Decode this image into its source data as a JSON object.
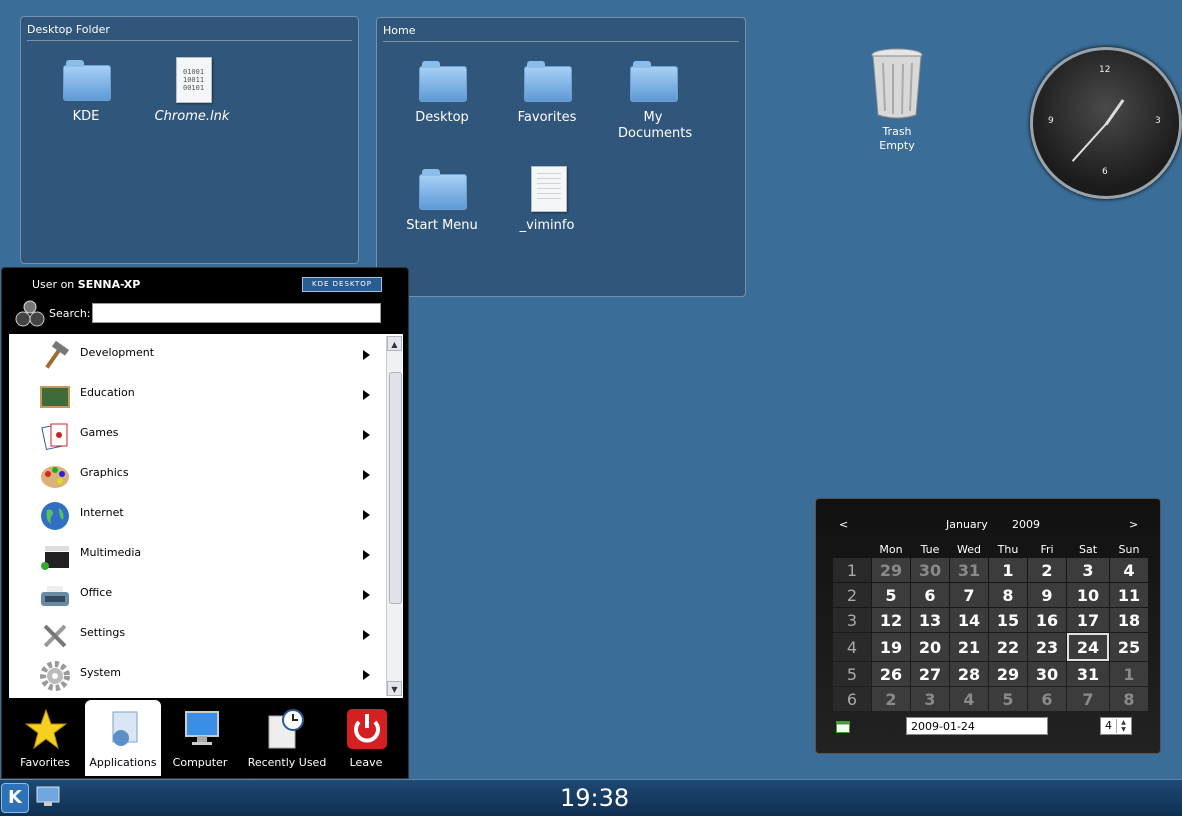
{
  "desktop_folder": {
    "title": "Desktop Folder",
    "items": [
      {
        "label": "KDE",
        "type": "folder"
      },
      {
        "label": "Chrome.lnk",
        "type": "file"
      }
    ]
  },
  "home_folder": {
    "title": "Home",
    "items": [
      {
        "label": "Desktop",
        "type": "folder"
      },
      {
        "label": "Favorites",
        "type": "folder"
      },
      {
        "label": "My Documents",
        "type": "folder"
      },
      {
        "label": "Start Menu",
        "type": "folder"
      },
      {
        "label": "_viminfo",
        "type": "file"
      }
    ]
  },
  "trash": {
    "label": "Trash",
    "status": "Empty"
  },
  "clock_widget": {
    "numerals": [
      "12",
      "3",
      "6",
      "9"
    ]
  },
  "calendar": {
    "prev": "<",
    "next": ">",
    "month": "January",
    "year": "2009",
    "weekdays": [
      "Mon",
      "Tue",
      "Wed",
      "Thu",
      "Fri",
      "Sat",
      "Sun"
    ],
    "weeks": [
      {
        "num": "1",
        "days": [
          "29",
          "30",
          "31",
          "1",
          "2",
          "3",
          "4"
        ]
      },
      {
        "num": "2",
        "days": [
          "5",
          "6",
          "7",
          "8",
          "9",
          "10",
          "11"
        ]
      },
      {
        "num": "3",
        "days": [
          "12",
          "13",
          "14",
          "15",
          "16",
          "17",
          "18"
        ]
      },
      {
        "num": "4",
        "days": [
          "19",
          "20",
          "21",
          "22",
          "23",
          "24",
          "25"
        ]
      },
      {
        "num": "5",
        "days": [
          "26",
          "27",
          "28",
          "29",
          "30",
          "31",
          "1"
        ]
      },
      {
        "num": "6",
        "days": [
          "2",
          "3",
          "4",
          "5",
          "6",
          "7",
          "8"
        ]
      }
    ],
    "date_field": "2009-01-24",
    "week_spin": "4",
    "selected_day": "24"
  },
  "launcher": {
    "user_prefix": "User on",
    "host": "SENNA-XP",
    "badge": "KDE DESKTOP",
    "search_label": "Search:",
    "search_value": "",
    "apps": [
      {
        "label": "Development",
        "icon": "hammer-icon"
      },
      {
        "label": "Education",
        "icon": "chalkboard-icon"
      },
      {
        "label": "Games",
        "icon": "cards-icon"
      },
      {
        "label": "Graphics",
        "icon": "palette-icon"
      },
      {
        "label": "Internet",
        "icon": "globe-icon"
      },
      {
        "label": "Multimedia",
        "icon": "clapperboard-icon"
      },
      {
        "label": "Office",
        "icon": "typewriter-icon"
      },
      {
        "label": "Settings",
        "icon": "tools-icon"
      },
      {
        "label": "System",
        "icon": "gear-icon"
      }
    ],
    "tabs": [
      {
        "label": "Favorites",
        "icon": "star-icon"
      },
      {
        "label": "Applications",
        "icon": "applications-icon"
      },
      {
        "label": "Computer",
        "icon": "monitor-icon"
      },
      {
        "label": "Recently Used",
        "icon": "clock-document-icon"
      },
      {
        "label": "Leave",
        "icon": "power-icon"
      }
    ],
    "active_tab": "Applications"
  },
  "taskbar": {
    "clock": "19:38"
  },
  "colors": {
    "desktop": "#3a6d97",
    "taskbar": "#0e2f52",
    "folder": "#6fa8e0"
  }
}
